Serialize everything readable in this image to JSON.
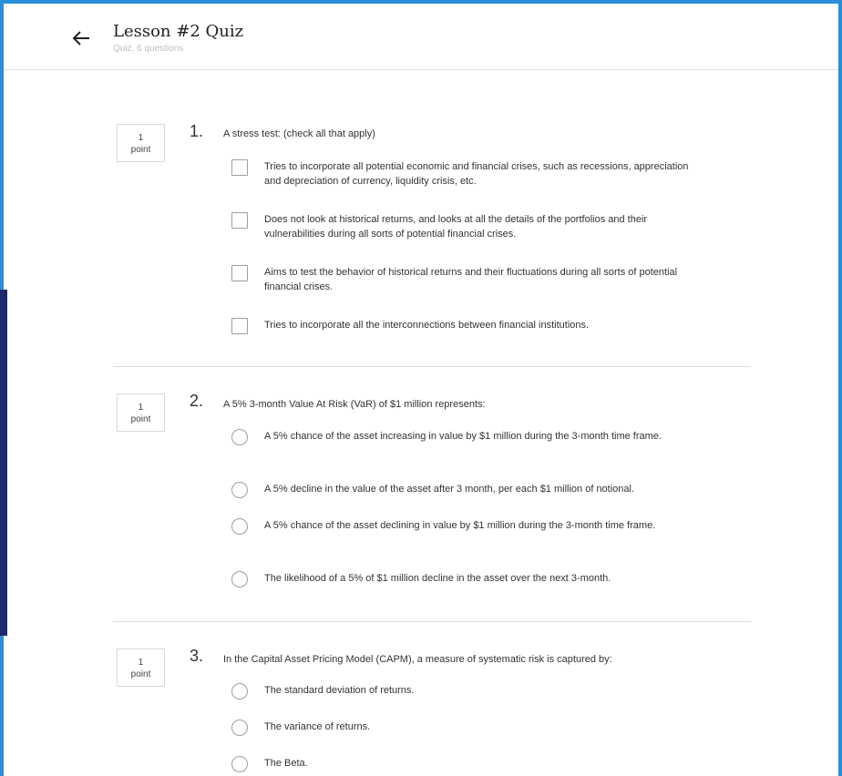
{
  "header": {
    "title": "Lesson #2 Quiz",
    "subtitle": "Quiz, 6 questions"
  },
  "questions": [
    {
      "points": "1",
      "points_label": "point",
      "number": "1.",
      "text": "A stress test: (check all that apply)",
      "input_type": "checkbox",
      "options": [
        "Tries to incorporate all potential economic and financial crises, such as recessions, appreciation and depreciation of currency, liquidity crisis, etc.",
        "Does not look at historical returns, and looks at all the details of the portfolios and their vulnerabilities during all sorts of potential financial crises.",
        "Aims to test the behavior of historical returns and their fluctuations during all sorts of potential financial crises.",
        "Tries to incorporate all the interconnections between financial institutions."
      ]
    },
    {
      "points": "1",
      "points_label": "point",
      "number": "2.",
      "text": "A 5% 3-month Value At Risk (VaR) of $1 million represents:",
      "input_type": "radio",
      "options": [
        "A 5% chance of the asset increasing in value by $1 million during the 3-month time frame.",
        "A 5% decline in the value of the asset after 3 month, per each $1 million of notional.",
        "A 5% chance of the asset declining in value by $1 million during the 3-month time frame.",
        "The likelihood of a 5% of $1 million decline in the asset over the next 3-month."
      ]
    },
    {
      "points": "1",
      "points_label": "point",
      "number": "3.",
      "text": "In the Capital Asset Pricing Model (CAPM), a measure of systematic risk is captured by:",
      "input_type": "radio",
      "options": [
        "The standard deviation of returns.",
        "The variance of returns.",
        "The Beta."
      ]
    }
  ]
}
